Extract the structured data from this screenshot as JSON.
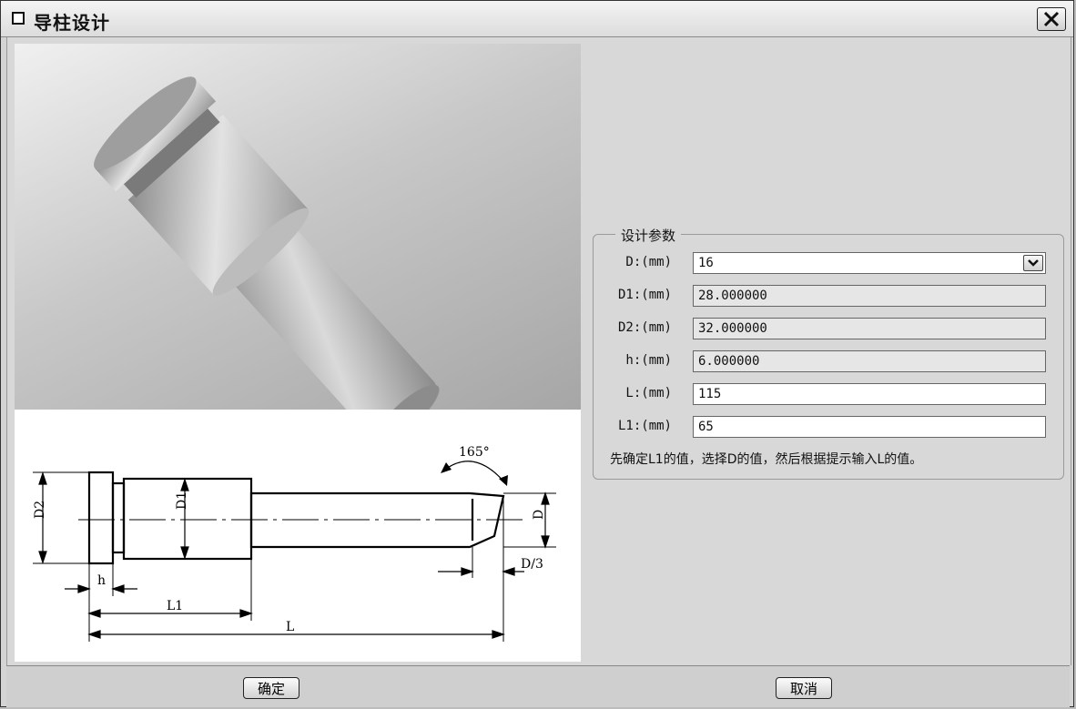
{
  "window": {
    "title": "导柱设计"
  },
  "params": {
    "legend": "设计参数",
    "rows": [
      {
        "label": "D:(mm)",
        "value": "16"
      },
      {
        "label": "D1:(mm)",
        "value": "28.000000"
      },
      {
        "label": "D2:(mm)",
        "value": "32.000000"
      },
      {
        "label": "h:(mm)",
        "value": "6.000000"
      },
      {
        "label": "L:(mm)",
        "value": "115"
      },
      {
        "label": "L1:(mm)",
        "value": "65"
      }
    ],
    "hint": "先确定L1的值，选择D的值，然后根据提示输入L的值。"
  },
  "drawing": {
    "angle": "165°",
    "d2": "D2",
    "d1": "D1",
    "d": "D",
    "d3": "D/3",
    "h": "h",
    "l1": "L1",
    "l": "L"
  },
  "buttons": {
    "ok": "确定",
    "cancel": "取消"
  }
}
